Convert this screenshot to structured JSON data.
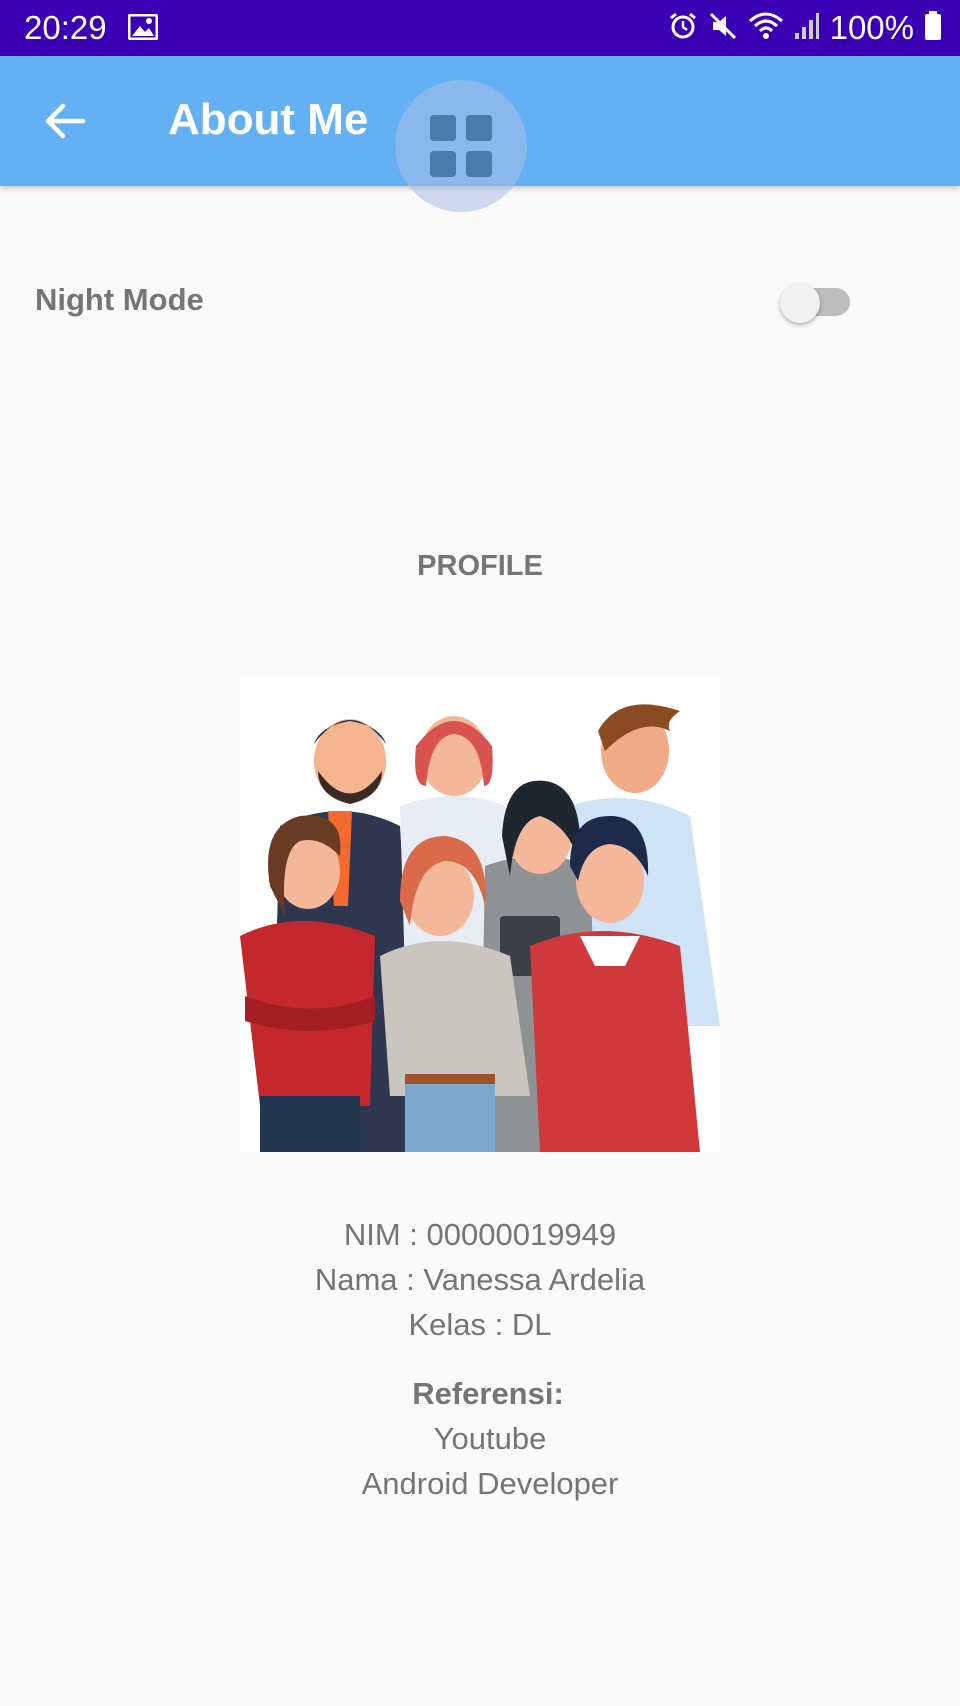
{
  "status_bar": {
    "time": "20:29",
    "battery": "100%",
    "icons": [
      "image-icon",
      "alarm-icon",
      "mute-icon",
      "wifi-icon",
      "signal-icon",
      "battery-icon"
    ]
  },
  "app_bar": {
    "title": "About Me",
    "color": "#64b0f4",
    "back_icon": "arrow-left-icon",
    "overlay_icon": "grid-icon"
  },
  "settings": {
    "night_mode_label": "Night Mode",
    "night_mode_on": false
  },
  "profile": {
    "heading": "PROFILE",
    "nim_line": "NIM   : 00000019949",
    "nama_line": "Nama  : Vanessa Ardelia",
    "kelas_line": "Kelas : DL",
    "referensi_label": "Referensi:",
    "references": [
      "Youtube",
      "Android Developer"
    ]
  },
  "colors": {
    "status_bar": "#3b00b3",
    "text_gray": "#757575",
    "background": "#fafafa"
  }
}
